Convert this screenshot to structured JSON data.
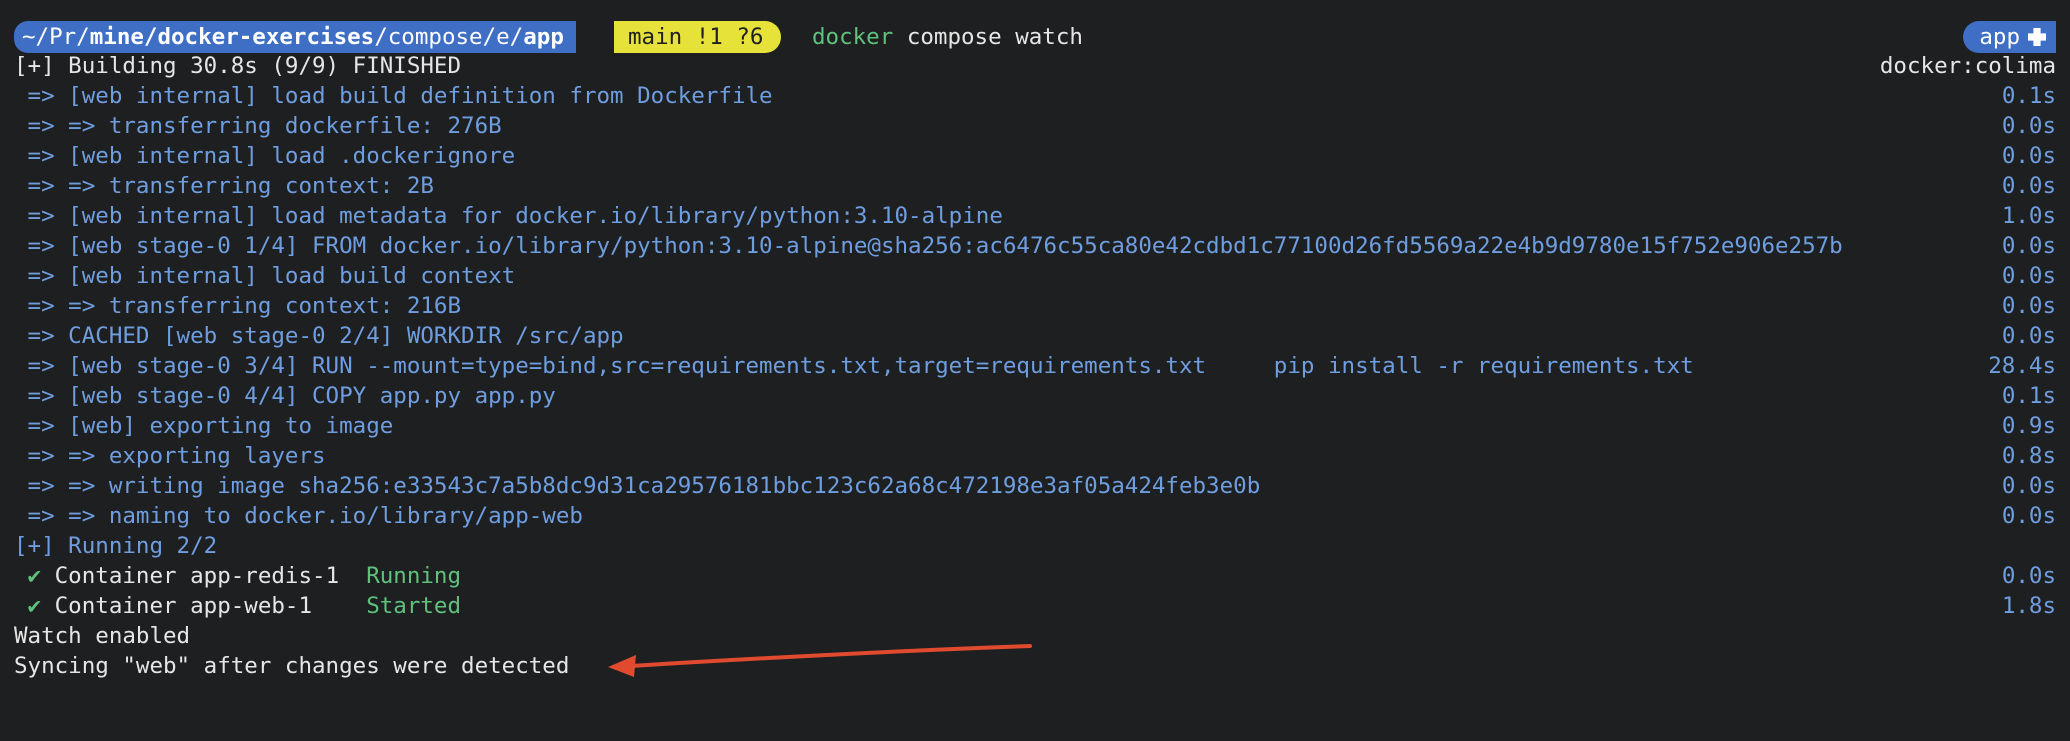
{
  "prompt": {
    "path_prefix": "~/Pr/",
    "path_bold": "mine/docker-exercises",
    "path_mid": "/compose/e/",
    "path_end": "app",
    "git": "main !1 ?6",
    "cmd_word": "docker",
    "cmd_rest": " compose watch",
    "right_label": "app",
    "right_icon": "docker-icon"
  },
  "build_header": {
    "text": "[+] Building 30.8s (9/9) FINISHED",
    "context": "docker:colima"
  },
  "steps": [
    {
      "text": " => [web internal] load build definition from Dockerfile",
      "time": "0.1s"
    },
    {
      "text": " => => transferring dockerfile: 276B",
      "time": "0.0s"
    },
    {
      "text": " => [web internal] load .dockerignore",
      "time": "0.0s"
    },
    {
      "text": " => => transferring context: 2B",
      "time": "0.0s"
    },
    {
      "text": " => [web internal] load metadata for docker.io/library/python:3.10-alpine",
      "time": "1.0s"
    },
    {
      "text": " => [web stage-0 1/4] FROM docker.io/library/python:3.10-alpine@sha256:ac6476c55ca80e42cdbd1c77100d26fd5569a22e4b9d9780e15f752e906e257b",
      "time": "0.0s"
    },
    {
      "text": " => [web internal] load build context",
      "time": "0.0s"
    },
    {
      "text": " => => transferring context: 216B",
      "time": "0.0s"
    },
    {
      "text": " => CACHED [web stage-0 2/4] WORKDIR /src/app",
      "time": "0.0s"
    },
    {
      "text": " => [web stage-0 3/4] RUN --mount=type=bind,src=requirements.txt,target=requirements.txt     pip install -r requirements.txt",
      "time": "28.4s"
    },
    {
      "text": " => [web stage-0 4/4] COPY app.py app.py",
      "time": "0.1s"
    },
    {
      "text": " => [web] exporting to image",
      "time": "0.9s"
    },
    {
      "text": " => => exporting layers",
      "time": "0.8s"
    },
    {
      "text": " => => writing image sha256:e33543c7a5b8dc9d31ca29576181bbc123c62a68c472198e3af05a424feb3e0b",
      "time": "0.0s"
    },
    {
      "text": " => => naming to docker.io/library/app-web",
      "time": "0.0s"
    }
  ],
  "running_header": "[+] Running 2/2",
  "containers": [
    {
      "check": " ✔",
      "name": " Container app-redis-1  ",
      "status": "Running",
      "time": "0.0s"
    },
    {
      "check": " ✔",
      "name": " Container app-web-1    ",
      "status": "Started",
      "time": "1.8s"
    }
  ],
  "messages": {
    "watch": "Watch enabled",
    "sync": "Syncing \"web\" after changes were detected"
  },
  "colors": {
    "background": "#1e1f21",
    "step_blue": "#6f9ee0",
    "status_green": "#5fc27c",
    "prompt_blue": "#3f6fc5",
    "git_yellow": "#e6e23a",
    "annotation_red": "#e04a2f"
  }
}
